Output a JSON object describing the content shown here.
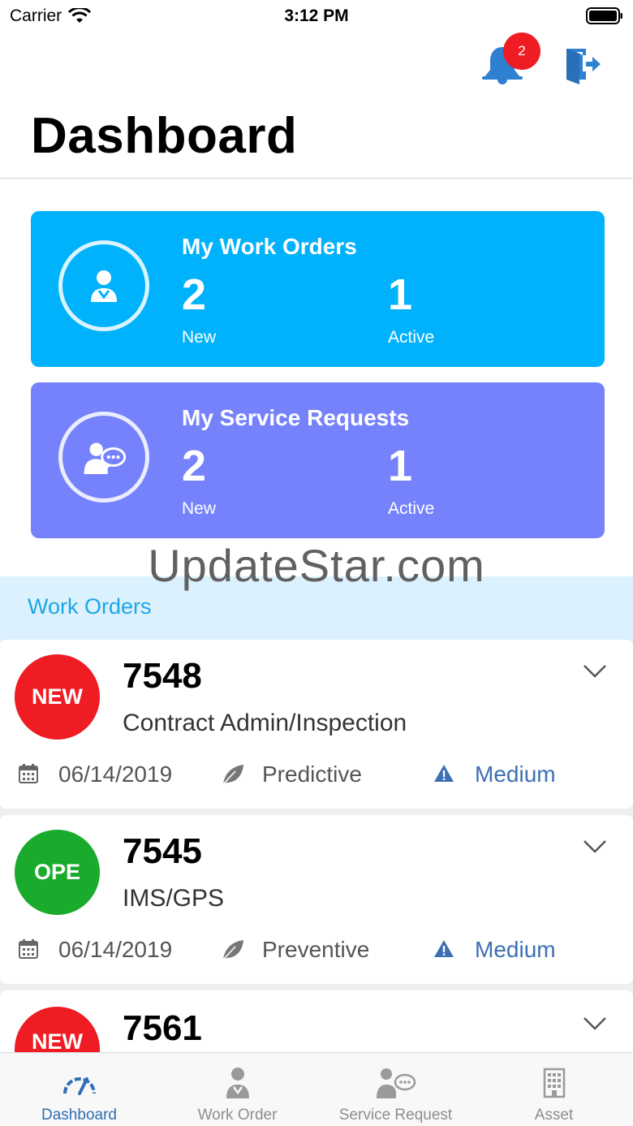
{
  "status_bar": {
    "carrier": "Carrier",
    "time": "3:12 PM"
  },
  "header": {
    "title": "Dashboard",
    "notification_count": "2"
  },
  "cards": [
    {
      "title": "My Work Orders",
      "new_count": "2",
      "new_label": "New",
      "active_count": "1",
      "active_label": "Active",
      "color": "#00b2fb",
      "icon": "technician-icon"
    },
    {
      "title": "My Service Requests",
      "new_count": "2",
      "new_label": "New",
      "active_count": "1",
      "active_label": "Active",
      "color": "#7582fb",
      "icon": "service-request-icon"
    }
  ],
  "watermark": "UpdateStar.com",
  "section": {
    "title": "Work Orders"
  },
  "work_orders": [
    {
      "status": "NEW",
      "status_color": "#ef1c24",
      "number": "7548",
      "description": "Contract Admin/Inspection",
      "date": "06/14/2019",
      "type": "Predictive",
      "priority": "Medium"
    },
    {
      "status": "OPE",
      "status_color": "#1aab2c",
      "number": "7545",
      "description": "IMS/GPS",
      "date": "06/14/2019",
      "type": "Preventive",
      "priority": "Medium"
    },
    {
      "status": "NEW",
      "status_color": "#ef1c24",
      "number": "7561"
    }
  ],
  "tabs": [
    {
      "label": "Dashboard",
      "icon": "speedometer-icon",
      "active": true
    },
    {
      "label": "Work Order",
      "icon": "technician-icon",
      "active": false
    },
    {
      "label": "Service Request",
      "icon": "service-request-icon",
      "active": false
    },
    {
      "label": "Asset",
      "icon": "building-icon",
      "active": false
    }
  ],
  "colors": {
    "accent": "#2f6fb4",
    "section_bg": "#dbf1fd",
    "section_text": "#1ca6e8",
    "priority": "#3d6fb4"
  }
}
